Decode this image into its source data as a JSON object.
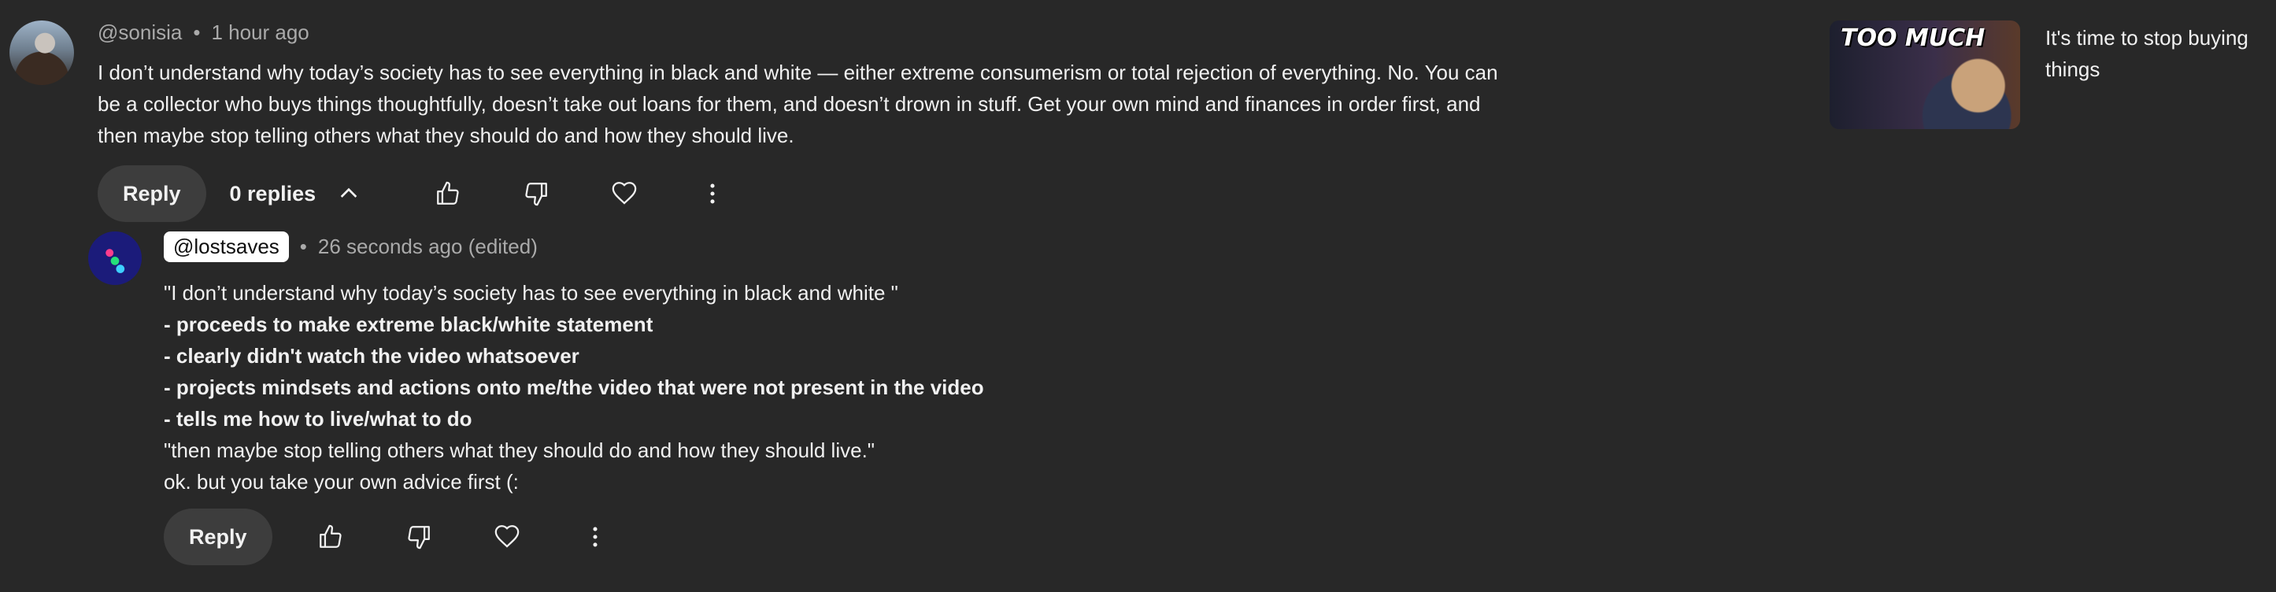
{
  "comment": {
    "handle": "@sonisia",
    "time": "1 hour ago",
    "text": "I don’t understand why today’s society has to see everything in black and white — either extreme consumerism or total rejection of everything. No. You can be a collector who buys things thoughtfully, doesn’t take out loans for them, and doesn’t drown in stuff. Get your own mind and finances in order first, and then maybe stop telling others what they should do and how they should live.",
    "reply_label": "Reply",
    "replies_label": "0 replies"
  },
  "reply": {
    "handle": "@lostsaves",
    "time": "26 seconds ago (edited)",
    "lines": [
      {
        "text": "\"I don’t understand why today’s society has to see everything in black and white \"",
        "bold": false
      },
      {
        "text": "- proceeds to make extreme black/white statement",
        "bold": true
      },
      {
        "text": "- clearly didn't watch the video whatsoever",
        "bold": true
      },
      {
        "text": "- projects mindsets and actions onto me/the video that were not present in the video",
        "bold": true
      },
      {
        "text": "- tells me how to live/what to do",
        "bold": true
      },
      {
        "text": "\"then maybe stop telling others what they should do and how they should live.\"",
        "bold": false
      },
      {
        "text": "ok. but you take your own advice first (:",
        "bold": false
      }
    ],
    "reply_label": "Reply"
  },
  "related": {
    "thumbnail_text": "TOO MUCH",
    "title": "It's time to stop buying things"
  },
  "icons": {
    "like": "thumbs-up-icon",
    "dislike": "thumbs-down-icon",
    "heart": "heart-icon",
    "more": "more-vertical-icon",
    "collapse": "chevron-up-icon"
  },
  "colors": {
    "background": "#282828",
    "pill": "#3d3d3d",
    "text": "#f1f1f1",
    "muted": "#aaaaaa"
  }
}
